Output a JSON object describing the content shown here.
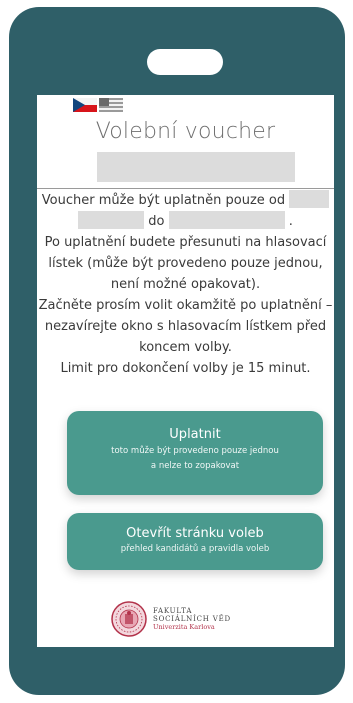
{
  "colors": {
    "frame": "#2f5f68",
    "button": "#4a9a8e",
    "redacted": "#dcdcdc",
    "brand_red": "#b2324a"
  },
  "languages": [
    {
      "name": "Czech",
      "icon": "czech-flag-icon"
    },
    {
      "name": "English",
      "icon": "us-flag-icon"
    }
  ],
  "title": "Volební voucher",
  "info": {
    "line1": "Voucher může být uplatněn pouze od",
    "to": "do",
    "period": ".",
    "paragraph2": "Po uplatnění budete přesunuti na hlasovací lístek (může být provedeno pouze jednou, není možné opakovat).",
    "paragraph3": "Začněte prosím volit okamžitě po uplatnění – nezavírejte okno s hlasovacím lístkem před koncem volby.",
    "paragraph4": "Limit pro dokončení volby je 15 minut."
  },
  "buttons": {
    "redeem": {
      "label": "Uplatnit",
      "sub1": "toto může být provedeno pouze jednou",
      "sub2": "a nelze to zopakovat"
    },
    "open": {
      "label": "Otevřít stránku voleb",
      "sub": "přehled kandidátů a pravidla voleb"
    }
  },
  "footer": {
    "line1": "FAKULTA",
    "line2": "SOCIÁLNÍCH VĚD",
    "line3": "Univerzita Karlova"
  }
}
